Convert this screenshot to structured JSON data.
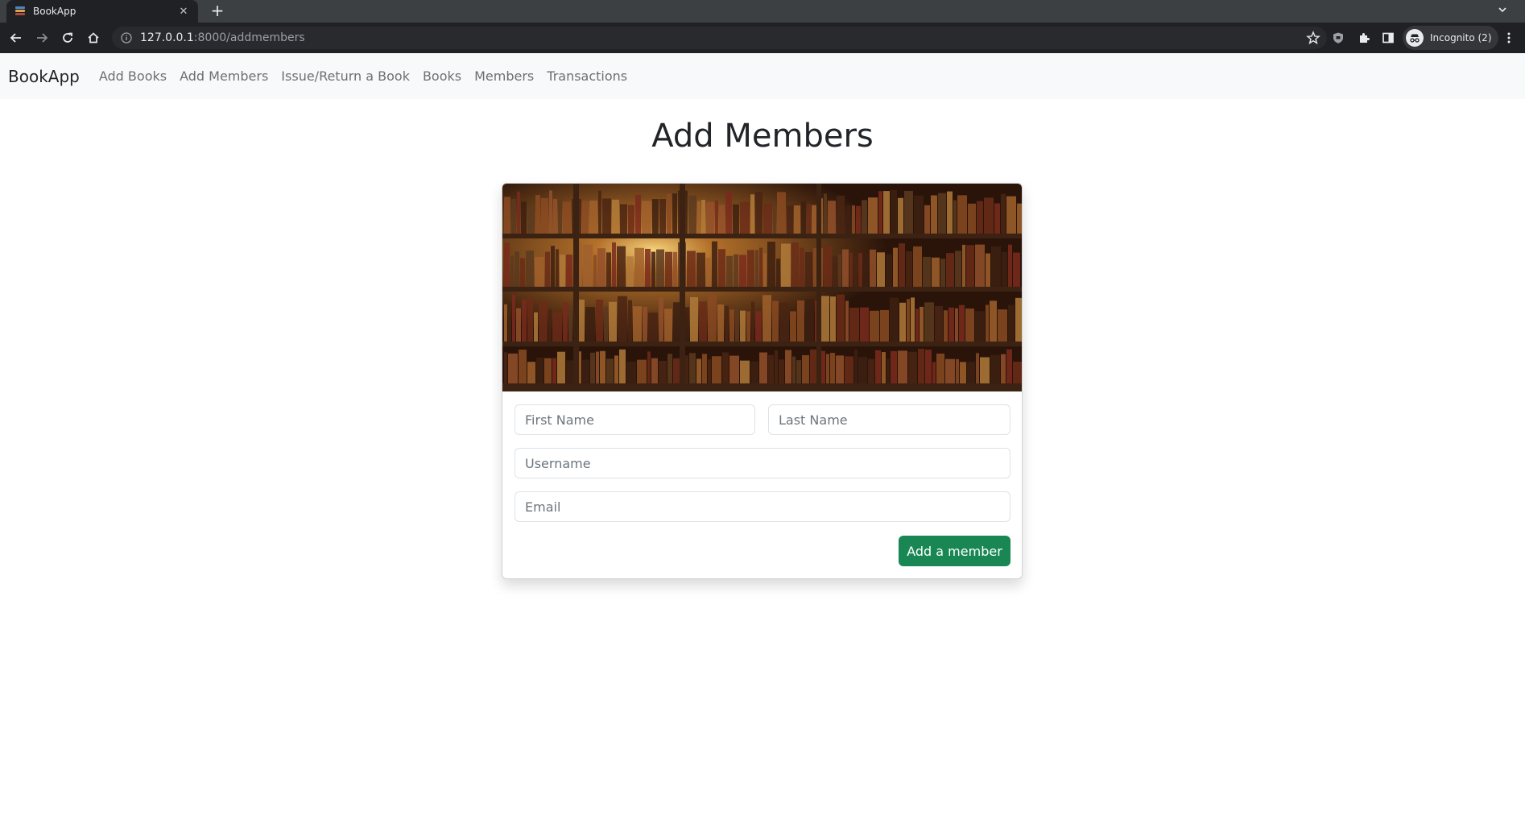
{
  "browser": {
    "tab_title": "BookApp",
    "url_host": "127.0.0.1",
    "url_path": ":8000/addmembers",
    "profile_label": "Incognito (2)"
  },
  "navbar": {
    "brand": "BookApp",
    "links": [
      "Add Books",
      "Add Members",
      "Issue/Return a Book",
      "Books",
      "Members",
      "Transactions"
    ]
  },
  "page": {
    "title": "Add Members"
  },
  "form": {
    "first_name_placeholder": "First Name",
    "last_name_placeholder": "Last Name",
    "username_placeholder": "Username",
    "email_placeholder": "Email",
    "submit_label": "Add a member"
  },
  "colors": {
    "navbar_bg": "#f8f9fa",
    "submit_bg": "#198754",
    "chrome_bg": "#202124"
  }
}
